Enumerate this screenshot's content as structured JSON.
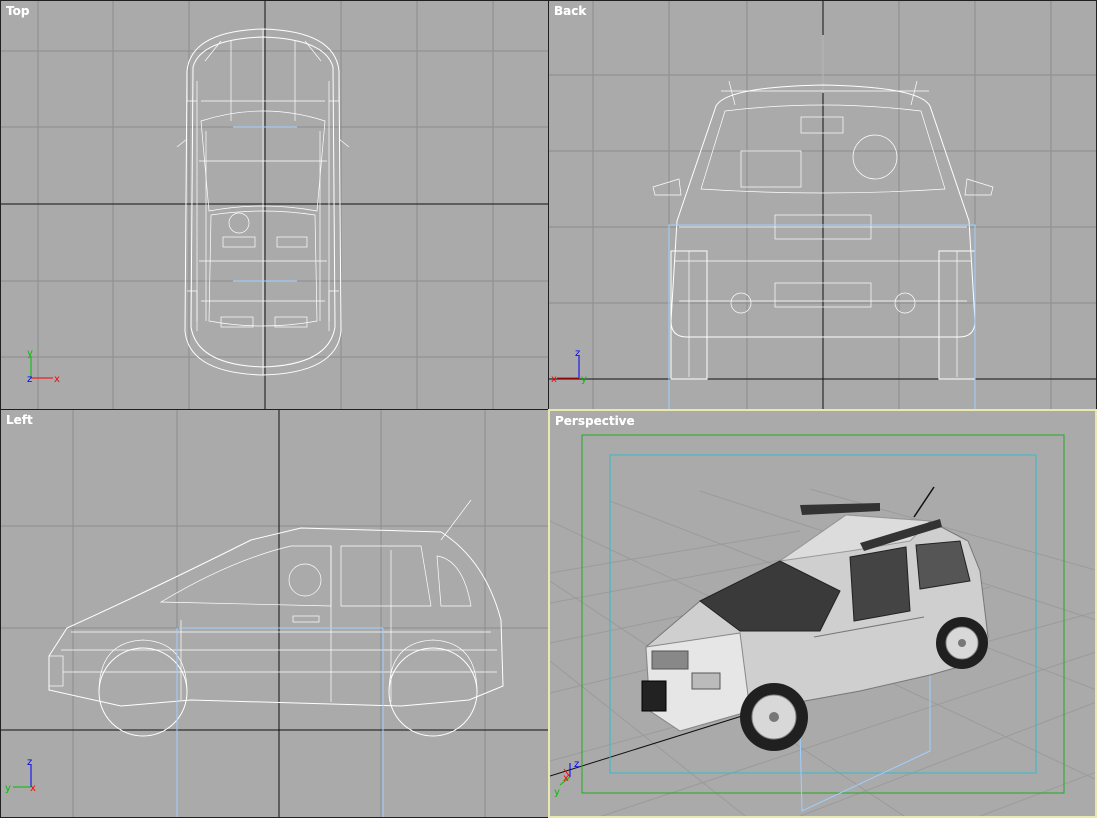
{
  "viewports": {
    "top": {
      "label": "Top",
      "gizmo": {
        "a": "y",
        "b": "x",
        "c": "z"
      }
    },
    "back": {
      "label": "Back",
      "gizmo": {
        "a": "z",
        "b": "x",
        "c": "y"
      }
    },
    "left": {
      "label": "Left",
      "gizmo": {
        "a": "z",
        "b": "y",
        "c": "x"
      }
    },
    "perspective": {
      "label": "Perspective",
      "gizmo": {
        "a": "z",
        "b": "x",
        "c": "y"
      }
    }
  },
  "colors": {
    "viewport_bg": "#aaaaaa",
    "grid": "#8c8c8c",
    "wireframe": "#ffffff",
    "bbox": "#9fd0ff",
    "active_border": "#e8e8b0",
    "safe_frame_outer": "#22aa22",
    "safe_frame_inner": "#33bbcc",
    "axis_x": "#ff0000",
    "axis_y": "#00c000",
    "axis_z": "#0000ff"
  },
  "icons": {
    "gizmo": "axis-tripod-icon"
  }
}
